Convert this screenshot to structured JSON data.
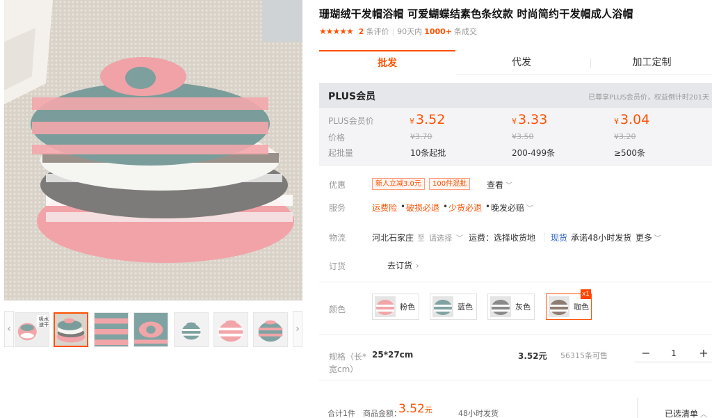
{
  "product": {
    "title": "珊瑚绒干发帽浴帽 可爱蝴蝶结素色条纹款 时尚简约干发帽成人浴帽",
    "stars": "★★★★★",
    "review_count": "2",
    "review_suffix": "条评价",
    "sep": "|",
    "sales_prefix": "90天内",
    "sales_count": "1000+",
    "sales_suffix": "条成交"
  },
  "gallery": {
    "thumb_left": "‹",
    "thumb_right": "›",
    "first_thumb_text_1": "吸水",
    "first_thumb_text_2": "速干",
    "active_thumb": 1
  },
  "tabs": [
    {
      "label": "批发",
      "active": true
    },
    {
      "label": "代发",
      "active": false
    },
    {
      "label": "加工定制",
      "active": false
    }
  ],
  "plus": {
    "title": "PLUS会员",
    "note": "已尊享PLUS会员价，权益倒计时201天",
    "price_label": "PLUS会员价",
    "orig_label": "价格",
    "batch_label": "起批量",
    "currency": "¥",
    "tiers": [
      {
        "price": "3.52",
        "orig": "¥3.70",
        "batch": "10条起批"
      },
      {
        "price": "3.33",
        "orig": "¥3.50",
        "batch": "200-499条"
      },
      {
        "price": "3.04",
        "orig": "¥3.20",
        "batch": "≥500条"
      }
    ]
  },
  "promo": {
    "label": "优惠",
    "tags": [
      "新人立减3.0元",
      "100件混批"
    ],
    "more": "查看"
  },
  "service": {
    "label": "服务",
    "items": [
      "运费险",
      "破损必退",
      "少货必退",
      "晚发必赔"
    ],
    "dot": "•"
  },
  "logistics": {
    "label": "物流",
    "from": "河北石家庄",
    "to_word": "至",
    "choose": "请选择",
    "fee": "运费：选择收货地",
    "stock": "现货",
    "promise": "承诺48小时发货",
    "more": "更多"
  },
  "order": {
    "label": "订货",
    "go": "去订货",
    "arrow": "›"
  },
  "colors": {
    "label": "颜色",
    "options": [
      {
        "name": "粉色",
        "stripe": "#f2a5a8"
      },
      {
        "name": "蓝色",
        "stripe": "#7fa3a2"
      },
      {
        "name": "灰色",
        "stripe": "#8a8a8a"
      },
      {
        "name": "咖色",
        "stripe": "#8e7b72"
      }
    ],
    "selected_index": 3,
    "selected_badge": "x1"
  },
  "spec": {
    "label_line1": "规格（长*",
    "label_line2": "宽cm）",
    "size": "25*27cm",
    "price": "3.52元",
    "stock": "56315条可售",
    "qty": "1",
    "minus": "−",
    "plus": "+"
  },
  "footer": {
    "total_count": "合计1件",
    "amount_label": "商品金额：",
    "amount": "3.52",
    "amount_unit": "元",
    "ship": "48小时发货",
    "selected_list": "已选清单"
  },
  "theme": {
    "accent": "#ff5000",
    "pink": "#f2a5a8",
    "teal": "#7fa3a2",
    "gray": "#8a8a8a",
    "brown": "#8e7b72"
  }
}
